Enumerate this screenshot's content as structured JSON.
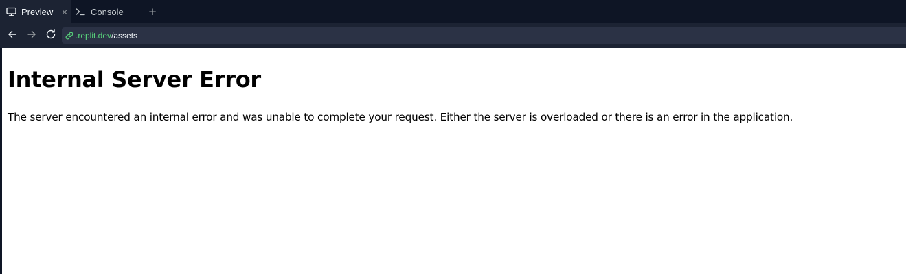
{
  "tabs": {
    "preview": {
      "label": "Preview",
      "icon": "monitor-icon",
      "active": true
    },
    "preview_close": "×",
    "console": {
      "label": "Console",
      "icon": "terminal-icon",
      "active": false
    },
    "new_tab": "+"
  },
  "toolbar": {
    "back_icon": "arrow-left-icon",
    "forward_icon": "arrow-right-icon",
    "reload_icon": "reload-icon",
    "url": {
      "link_icon": "link-icon",
      "host": ".replit.dev",
      "path": "/assets"
    }
  },
  "page": {
    "heading": "Internal Server Error",
    "message": "The server encountered an internal error and was unable to complete your request. Either the server is overloaded or there is an error in the application."
  },
  "colors": {
    "app_background": "#0e1525",
    "active_tab": "#1c2333",
    "url_bar": "#2b3245",
    "url_host": "#58d47b",
    "text_light": "#f5f9fc",
    "page_background": "#ffffff"
  }
}
